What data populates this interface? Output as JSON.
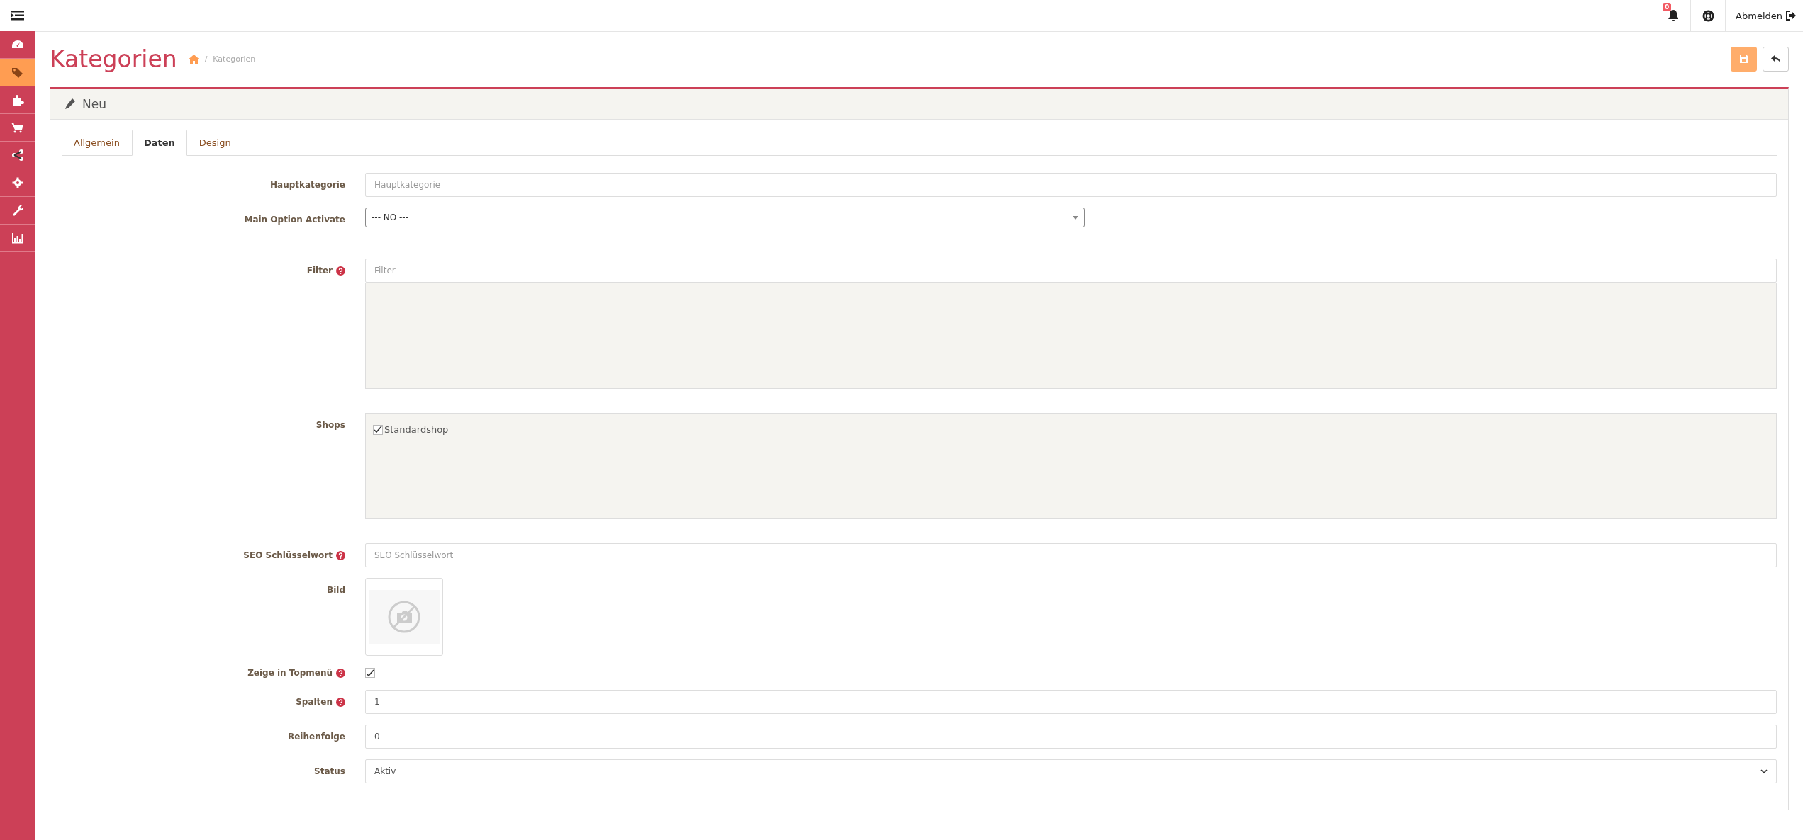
{
  "sidebar": {
    "items": [
      {
        "selected": false
      },
      {
        "selected": true
      },
      {
        "selected": false
      },
      {
        "selected": false
      },
      {
        "selected": false
      },
      {
        "selected": false
      },
      {
        "selected": false
      },
      {
        "selected": false
      }
    ]
  },
  "topbar": {
    "notification_count": "0",
    "logout": "Abmelden"
  },
  "page": {
    "title": "Kategorien",
    "separator": "/",
    "breadcrumb": [
      "Kategorien"
    ]
  },
  "panel": {
    "title": "Neu"
  },
  "tabs": [
    {
      "label": "Allgemein",
      "selected": false
    },
    {
      "label": "Daten",
      "selected": true
    },
    {
      "label": "Design",
      "selected": false
    }
  ],
  "fields": [
    {
      "kind": "text",
      "label": "Hauptkategorie",
      "help": false,
      "placeholder": "Hauptkategorie"
    },
    {
      "kind": "combo",
      "label": "Main Option Activate",
      "help": false,
      "value": "--- NO ---"
    },
    {
      "kind": "filter",
      "label": "Filter",
      "help": true,
      "placeholder": "Filter"
    },
    {
      "kind": "checklist",
      "label": "Shops",
      "help": false,
      "options": [
        {
          "label": "Standardshop",
          "checked": true
        }
      ]
    },
    {
      "kind": "text",
      "label": "SEO Schlüsselwort",
      "help": true,
      "placeholder": "SEO Schlüsselwort"
    },
    {
      "kind": "image",
      "label": "Bild",
      "help": false
    },
    {
      "kind": "checkbox",
      "label": "Zeige in Topmenü",
      "help": true,
      "checked": true
    },
    {
      "kind": "text",
      "label": "Spalten",
      "help": true,
      "value": "1"
    },
    {
      "kind": "text",
      "label": "Reihenfolge",
      "help": false,
      "value": "0"
    },
    {
      "kind": "select",
      "label": "Status",
      "help": false,
      "value": "Aktiv"
    }
  ]
}
